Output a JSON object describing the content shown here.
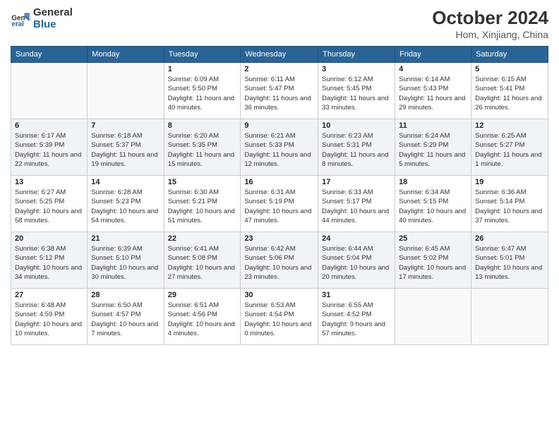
{
  "logo": {
    "general": "General",
    "blue": "Blue"
  },
  "title": "October 2024",
  "location": "Hom, Xinjiang, China",
  "days_of_week": [
    "Sunday",
    "Monday",
    "Tuesday",
    "Wednesday",
    "Thursday",
    "Friday",
    "Saturday"
  ],
  "weeks": [
    [
      {
        "day": "",
        "info": ""
      },
      {
        "day": "",
        "info": ""
      },
      {
        "day": "1",
        "info": "Sunrise: 6:09 AM\nSunset: 5:50 PM\nDaylight: 11 hours and 40 minutes."
      },
      {
        "day": "2",
        "info": "Sunrise: 6:11 AM\nSunset: 5:47 PM\nDaylight: 11 hours and 36 minutes."
      },
      {
        "day": "3",
        "info": "Sunrise: 6:12 AM\nSunset: 5:45 PM\nDaylight: 11 hours and 33 minutes."
      },
      {
        "day": "4",
        "info": "Sunrise: 6:14 AM\nSunset: 5:43 PM\nDaylight: 11 hours and 29 minutes."
      },
      {
        "day": "5",
        "info": "Sunrise: 6:15 AM\nSunset: 5:41 PM\nDaylight: 11 hours and 26 minutes."
      }
    ],
    [
      {
        "day": "6",
        "info": "Sunrise: 6:17 AM\nSunset: 5:39 PM\nDaylight: 11 hours and 22 minutes."
      },
      {
        "day": "7",
        "info": "Sunrise: 6:18 AM\nSunset: 5:37 PM\nDaylight: 11 hours and 19 minutes."
      },
      {
        "day": "8",
        "info": "Sunrise: 6:20 AM\nSunset: 5:35 PM\nDaylight: 11 hours and 15 minutes."
      },
      {
        "day": "9",
        "info": "Sunrise: 6:21 AM\nSunset: 5:33 PM\nDaylight: 11 hours and 12 minutes."
      },
      {
        "day": "10",
        "info": "Sunrise: 6:23 AM\nSunset: 5:31 PM\nDaylight: 11 hours and 8 minutes."
      },
      {
        "day": "11",
        "info": "Sunrise: 6:24 AM\nSunset: 5:29 PM\nDaylight: 11 hours and 5 minutes."
      },
      {
        "day": "12",
        "info": "Sunrise: 6:25 AM\nSunset: 5:27 PM\nDaylight: 11 hours and 1 minute."
      }
    ],
    [
      {
        "day": "13",
        "info": "Sunrise: 6:27 AM\nSunset: 5:25 PM\nDaylight: 10 hours and 58 minutes."
      },
      {
        "day": "14",
        "info": "Sunrise: 6:28 AM\nSunset: 5:23 PM\nDaylight: 10 hours and 54 minutes."
      },
      {
        "day": "15",
        "info": "Sunrise: 6:30 AM\nSunset: 5:21 PM\nDaylight: 10 hours and 51 minutes."
      },
      {
        "day": "16",
        "info": "Sunrise: 6:31 AM\nSunset: 5:19 PM\nDaylight: 10 hours and 47 minutes."
      },
      {
        "day": "17",
        "info": "Sunrise: 6:33 AM\nSunset: 5:17 PM\nDaylight: 10 hours and 44 minutes."
      },
      {
        "day": "18",
        "info": "Sunrise: 6:34 AM\nSunset: 5:15 PM\nDaylight: 10 hours and 40 minutes."
      },
      {
        "day": "19",
        "info": "Sunrise: 6:36 AM\nSunset: 5:14 PM\nDaylight: 10 hours and 37 minutes."
      }
    ],
    [
      {
        "day": "20",
        "info": "Sunrise: 6:38 AM\nSunset: 5:12 PM\nDaylight: 10 hours and 34 minutes."
      },
      {
        "day": "21",
        "info": "Sunrise: 6:39 AM\nSunset: 5:10 PM\nDaylight: 10 hours and 30 minutes."
      },
      {
        "day": "22",
        "info": "Sunrise: 6:41 AM\nSunset: 5:08 PM\nDaylight: 10 hours and 27 minutes."
      },
      {
        "day": "23",
        "info": "Sunrise: 6:42 AM\nSunset: 5:06 PM\nDaylight: 10 hours and 23 minutes."
      },
      {
        "day": "24",
        "info": "Sunrise: 6:44 AM\nSunset: 5:04 PM\nDaylight: 10 hours and 20 minutes."
      },
      {
        "day": "25",
        "info": "Sunrise: 6:45 AM\nSunset: 5:02 PM\nDaylight: 10 hours and 17 minutes."
      },
      {
        "day": "26",
        "info": "Sunrise: 6:47 AM\nSunset: 5:01 PM\nDaylight: 10 hours and 13 minutes."
      }
    ],
    [
      {
        "day": "27",
        "info": "Sunrise: 6:48 AM\nSunset: 4:59 PM\nDaylight: 10 hours and 10 minutes."
      },
      {
        "day": "28",
        "info": "Sunrise: 6:50 AM\nSunset: 4:57 PM\nDaylight: 10 hours and 7 minutes."
      },
      {
        "day": "29",
        "info": "Sunrise: 6:51 AM\nSunset: 4:56 PM\nDaylight: 10 hours and 4 minutes."
      },
      {
        "day": "30",
        "info": "Sunrise: 6:53 AM\nSunset: 4:54 PM\nDaylight: 10 hours and 0 minutes."
      },
      {
        "day": "31",
        "info": "Sunrise: 6:55 AM\nSunset: 4:52 PM\nDaylight: 9 hours and 57 minutes."
      },
      {
        "day": "",
        "info": ""
      },
      {
        "day": "",
        "info": ""
      }
    ]
  ]
}
